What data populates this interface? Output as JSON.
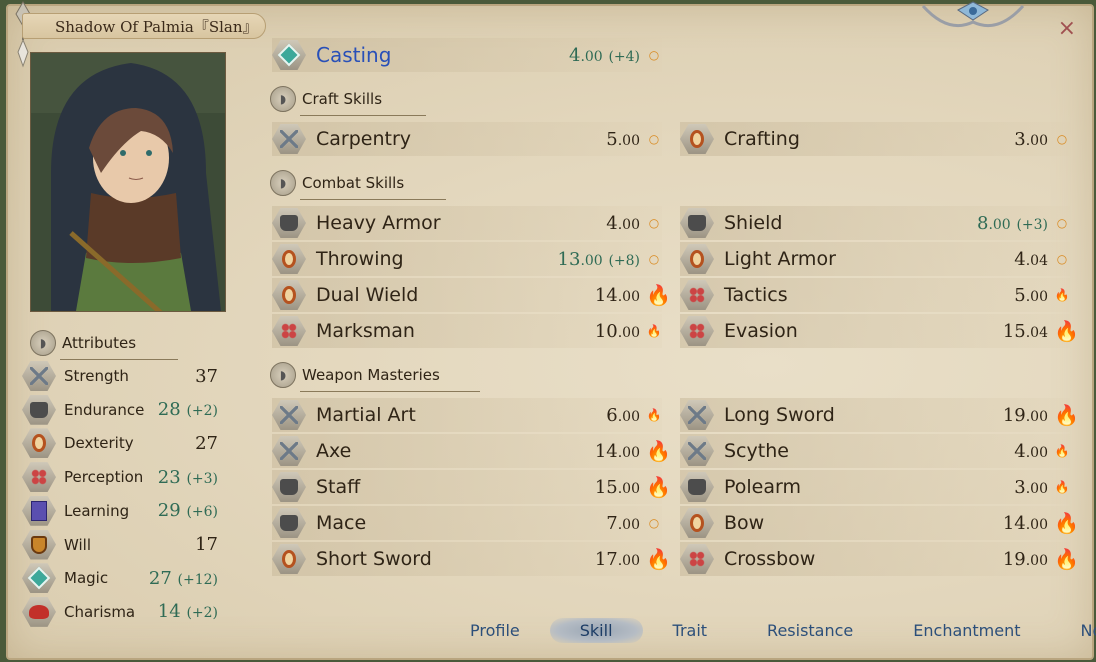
{
  "window": {
    "title": "Shadow Of Palmia『Slan』",
    "close_label": "×"
  },
  "attributes": {
    "header": "Attributes",
    "items": [
      {
        "name": "Strength",
        "value": "37",
        "bonus": "",
        "icon": "sword-icon"
      },
      {
        "name": "Endurance",
        "value": "28",
        "bonus": "(+2)",
        "icon": "armor-icon"
      },
      {
        "name": "Dexterity",
        "value": "27",
        "bonus": "",
        "icon": "ring-icon"
      },
      {
        "name": "Perception",
        "value": "23",
        "bonus": "(+3)",
        "icon": "dots-icon"
      },
      {
        "name": "Learning",
        "value": "29",
        "bonus": "(+6)",
        "icon": "book-icon"
      },
      {
        "name": "Will",
        "value": "17",
        "bonus": "",
        "icon": "shield-icon"
      },
      {
        "name": "Magic",
        "value": "27",
        "bonus": "(+12)",
        "icon": "magic-icon"
      },
      {
        "name": "Charisma",
        "value": "14",
        "bonus": "(+2)",
        "icon": "bow-icon"
      }
    ]
  },
  "casting": {
    "name": "Casting",
    "value": "4",
    "decimal": ".00",
    "bonus": "(+4)",
    "potential": "○"
  },
  "craft": {
    "header": "Craft Skills",
    "skills": [
      {
        "name": "Carpentry",
        "value": "5",
        "decimal": ".00",
        "bonus": "",
        "potential": "○"
      },
      {
        "name": "Crafting",
        "value": "3",
        "decimal": ".00",
        "bonus": "",
        "potential": "○"
      }
    ]
  },
  "combat": {
    "header": "Combat Skills",
    "skills": [
      {
        "name": "Heavy Armor",
        "value": "4",
        "decimal": ".00",
        "bonus": "",
        "potential": "○"
      },
      {
        "name": "Shield",
        "value": "8",
        "decimal": ".00",
        "bonus": "(+3)",
        "potential": "○"
      },
      {
        "name": "Throwing",
        "value": "13",
        "decimal": ".00",
        "bonus": "(+8)",
        "potential": "○"
      },
      {
        "name": "Light Armor",
        "value": "4",
        "decimal": ".04",
        "bonus": "",
        "potential": "○"
      },
      {
        "name": "Dual Wield",
        "value": "14",
        "decimal": ".00",
        "bonus": "",
        "potential": "🔥"
      },
      {
        "name": "Tactics",
        "value": "5",
        "decimal": ".00",
        "bonus": "",
        "potential": "🔥"
      },
      {
        "name": "Marksman",
        "value": "10",
        "decimal": ".00",
        "bonus": "",
        "potential": "🔥"
      },
      {
        "name": "Evasion",
        "value": "15",
        "decimal": ".04",
        "bonus": "",
        "potential": "🔥"
      }
    ]
  },
  "weapons": {
    "header": "Weapon Masteries",
    "skills": [
      {
        "name": "Martial Art",
        "value": "6",
        "decimal": ".00",
        "bonus": "",
        "potential": "🔥"
      },
      {
        "name": "Long Sword",
        "value": "19",
        "decimal": ".00",
        "bonus": "",
        "potential": "🔥"
      },
      {
        "name": "Axe",
        "value": "14",
        "decimal": ".00",
        "bonus": "",
        "potential": "🔥"
      },
      {
        "name": "Scythe",
        "value": "4",
        "decimal": ".00",
        "bonus": "",
        "potential": "🔥"
      },
      {
        "name": "Staff",
        "value": "15",
        "decimal": ".00",
        "bonus": "",
        "potential": "🔥"
      },
      {
        "name": "Polearm",
        "value": "3",
        "decimal": ".00",
        "bonus": "",
        "potential": "🔥"
      },
      {
        "name": "Mace",
        "value": "7",
        "decimal": ".00",
        "bonus": "",
        "potential": "○"
      },
      {
        "name": "Bow",
        "value": "14",
        "decimal": ".00",
        "bonus": "",
        "potential": "🔥"
      },
      {
        "name": "Short Sword",
        "value": "17",
        "decimal": ".00",
        "bonus": "",
        "potential": "🔥"
      },
      {
        "name": "Crossbow",
        "value": "19",
        "decimal": ".00",
        "bonus": "",
        "potential": "🔥"
      }
    ]
  },
  "tabs": [
    {
      "label": "Profile",
      "active": false
    },
    {
      "label": "Skill",
      "active": true
    },
    {
      "label": "Trait",
      "active": false
    },
    {
      "label": "Resistance",
      "active": false
    },
    {
      "label": "Enchantment",
      "active": false
    },
    {
      "label": "Note",
      "active": false
    }
  ]
}
